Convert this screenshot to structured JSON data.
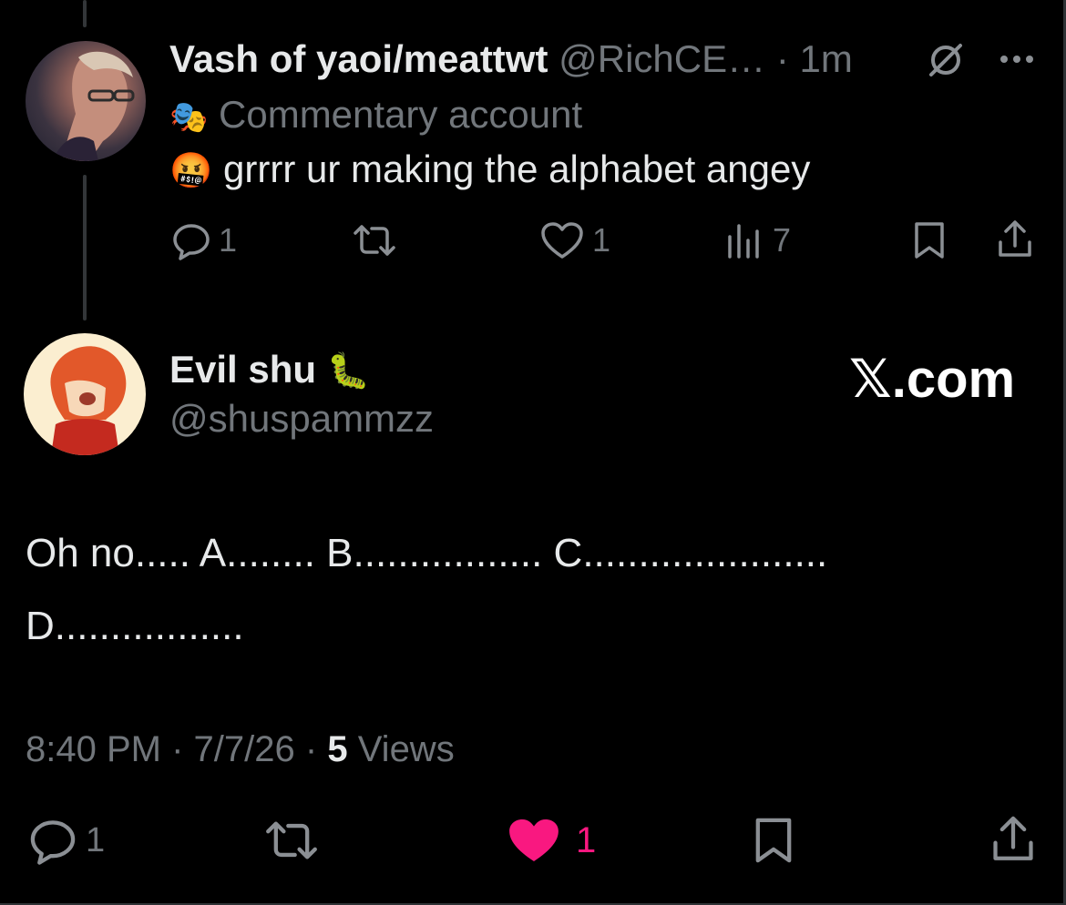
{
  "parent_tweet": {
    "display_name": "Vash of yaoi/meattwt",
    "handle": "@RichCE…",
    "time": "· 1m",
    "label_emoji": "🎭",
    "label_text": "Commentary account",
    "body_emoji": "🤬",
    "body_text": "grrrr ur making the alphabet angey",
    "replies": "1",
    "likes": "1",
    "views": "7"
  },
  "main_tweet": {
    "display_name": "Evil shu",
    "name_emoji": "🐛",
    "handle": "@shuspammzz",
    "watermark": "𝕏.com",
    "text_line1": "Oh no..... A........ B................. C......................",
    "text_line2": "D.................",
    "time": "8:40 PM",
    "sep1": "·",
    "date": "7/7/26",
    "sep2": "·",
    "views_count": "5",
    "views_label": "Views",
    "replies": "1",
    "likes": "1"
  },
  "colors": {
    "background": "#000000",
    "text": "#e7e9ea",
    "muted": "#71767b",
    "like_active": "#f91880",
    "thread_line": "#333639"
  },
  "icons": [
    "grok-icon",
    "more-icon",
    "reply-icon",
    "retweet-icon",
    "like-icon",
    "views-icon",
    "bookmark-icon",
    "share-icon",
    "theater-masks-icon"
  ]
}
